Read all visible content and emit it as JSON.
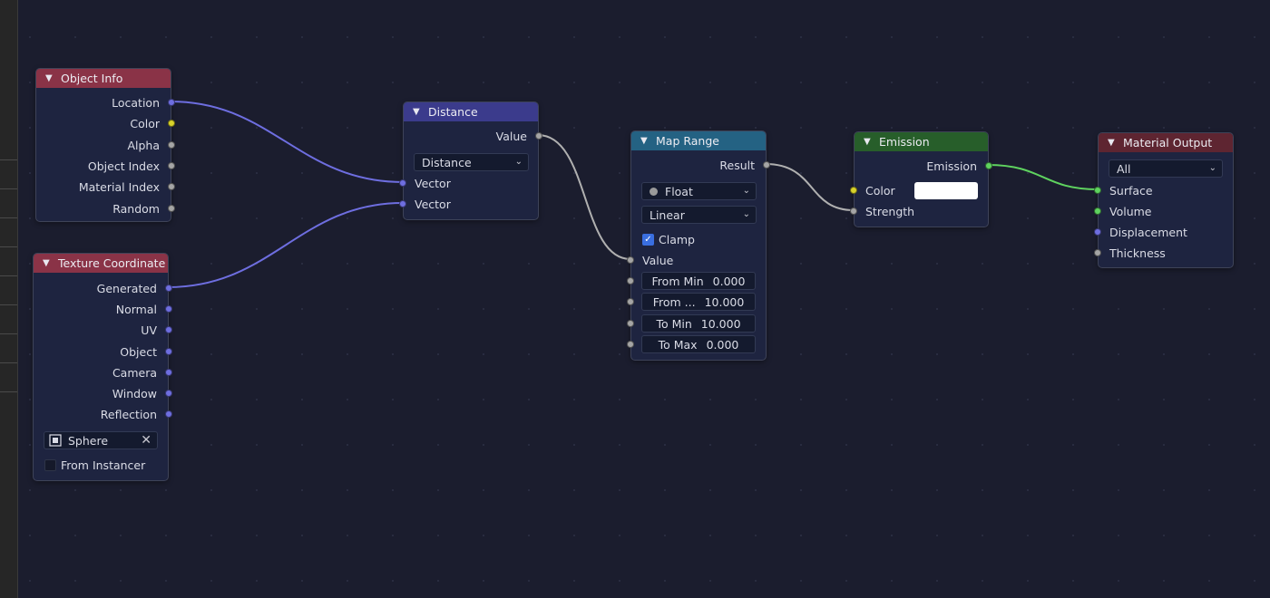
{
  "colors": {
    "background": "#1b1d2e",
    "node_body": "#1e2440",
    "header_input": "#8a3347",
    "header_converter": "#3b3b8c",
    "header_mapping": "#246283",
    "header_shader": "#275e2a",
    "header_output": "#5e2531",
    "socket_vector": "#6e6ee0",
    "socket_color": "#d8d22a",
    "socket_float": "#a5a5a5",
    "socket_shader": "#5fd35f",
    "wire_vector": "#6e6ee0",
    "wire_float": "#b0b0b0",
    "wire_shader": "#5fd35f"
  },
  "nodes": {
    "object_info": {
      "title": "Object Info",
      "outputs": [
        "Location",
        "Color",
        "Alpha",
        "Object Index",
        "Material Index",
        "Random"
      ]
    },
    "texture_coordinate": {
      "title": "Texture Coordinate",
      "outputs": [
        "Generated",
        "Normal",
        "UV",
        "Object",
        "Camera",
        "Window",
        "Reflection"
      ],
      "object_field": "Sphere",
      "from_instancer_label": "From Instancer",
      "from_instancer_checked": false
    },
    "distance": {
      "title": "Distance",
      "output": "Value",
      "operation": "Distance",
      "inputs": [
        "Vector",
        "Vector"
      ]
    },
    "map_range": {
      "title": "Map Range",
      "output": "Result",
      "data_type": "Float",
      "interpolation": "Linear",
      "clamp_label": "Clamp",
      "clamp_checked": true,
      "value_label": "Value",
      "fields": [
        {
          "label": "From Min",
          "value": "0.000"
        },
        {
          "label": "From ...",
          "value": "10.000"
        },
        {
          "label": "To Min",
          "value": "10.000"
        },
        {
          "label": "To Max",
          "value": "0.000"
        }
      ]
    },
    "emission": {
      "title": "Emission",
      "output": "Emission",
      "color_label": "Color",
      "color_value": "#ffffff",
      "strength_label": "Strength"
    },
    "material_output": {
      "title": "Material Output",
      "target": "All",
      "inputs": [
        "Surface",
        "Volume",
        "Displacement",
        "Thickness"
      ]
    }
  },
  "icons": {
    "collapse": "chevron-down-icon",
    "object": "object-cube-icon",
    "clear": "close-icon",
    "dropdown": "chevron-down-icon"
  }
}
